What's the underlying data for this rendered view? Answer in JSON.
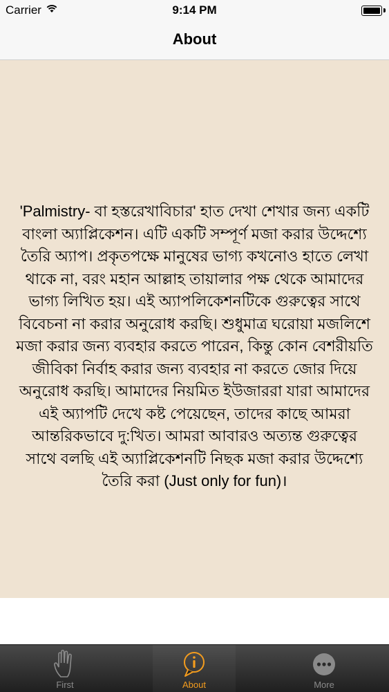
{
  "status_bar": {
    "carrier": "Carrier",
    "time": "9:14 PM",
    "battery_level_percent": 100
  },
  "nav": {
    "title": "About"
  },
  "about": {
    "text": "'Palmistry- বা হস্তরেখাবিচার' হাত দেখা শেখার জন্য একটি বাংলা অ্যাপ্লিকেশন। এটি একটি সম্পূর্ণ মজা করার উদ্দেশ্যে তৈরি অ্যাপ। প্রকৃতপক্ষে মানুষের ভাগ্য কখনোও হাতে লেখা থাকে না, বরং মহান আল্লাহ তায়ালার পক্ষ থেকে আমাদের ভাগ্য লিখিত হয়। এই অ্যাপলিকেশনটিকে গুরুত্বের সাথে বিবেচনা না করার অনুরোধ করছি। শুধুমাত্র ঘরোয়া মজলিশে মজা করার জন্য ব্যবহার করতে পারেন, কিন্তু কোন বেশরীয়তি জীবিকা নির্বাহ করার জন্য ব্যবহার না করতে জোর দিয়ে অনুরোধ করছি। আমাদের নিয়মিত ইউজাররা যারা আমাদের এই অ্যাপটি দেখে কষ্ট পেয়েছেন, তাদের কাছে আমরা আন্তরিকভাবে দু:খিত। আমরা আবারও অত্যন্ত গুরুত্বের সাথে বলছি এই অ্যাপ্লিকেশনটি নিছক মজা করার উদ্দেশ্যে তৈরি করা (Just only for fun)।"
  },
  "tabs": [
    {
      "label": "First",
      "icon": "hand-icon",
      "active": false
    },
    {
      "label": "About",
      "icon": "info-icon",
      "active": true
    },
    {
      "label": "More",
      "icon": "more-icon",
      "active": false
    }
  ],
  "colors": {
    "content_background": "#efe3d2",
    "active_tab": "#f39c1e",
    "inactive_tab": "#8a8a8a"
  }
}
